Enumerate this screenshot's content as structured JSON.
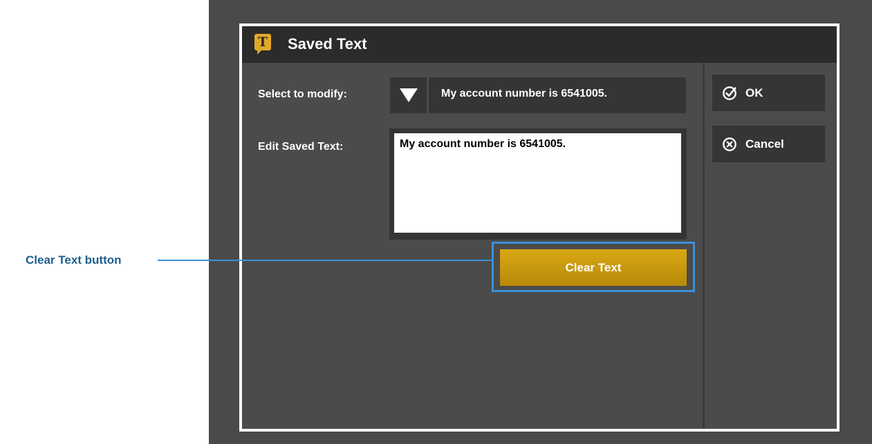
{
  "dialog": {
    "title": "Saved Text",
    "title_icon_letter": "T",
    "title_icon": "saved-text-icon",
    "accent_color": "#e3a82a"
  },
  "form": {
    "select_label": "Select to modify:",
    "select_value": "My account number is 6541005.",
    "edit_label": "Edit Saved Text:",
    "edit_value": "My account number is 6541005.",
    "clear_button": "Clear Text"
  },
  "actions": {
    "ok": "OK",
    "ok_icon": "check-circle-icon",
    "cancel": "Cancel",
    "cancel_icon": "x-circle-icon"
  },
  "annotation": {
    "callout": "Clear Text button",
    "highlight_color": "#3d8fdc"
  }
}
